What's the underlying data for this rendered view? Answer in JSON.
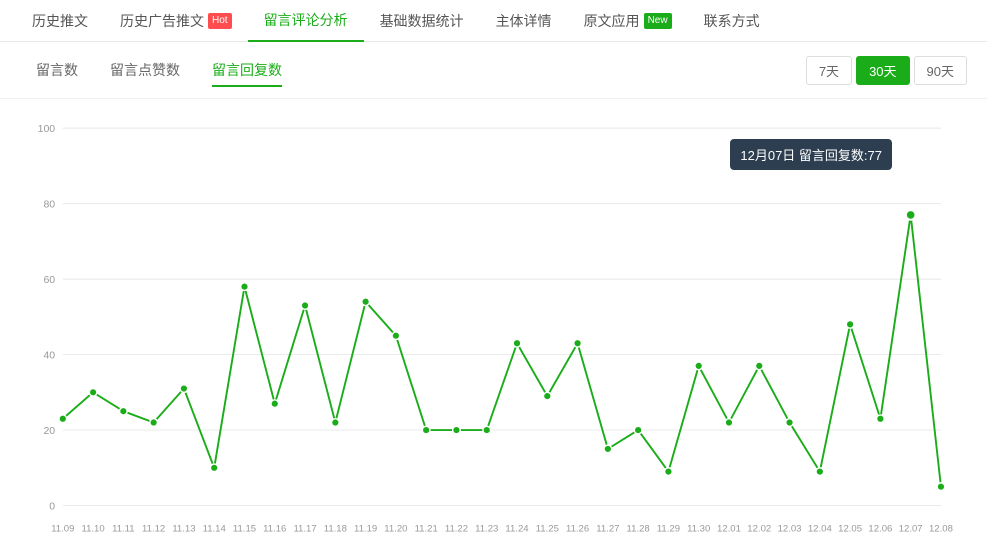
{
  "nav": {
    "items": [
      {
        "label": "历史推文",
        "active": false,
        "badge": null
      },
      {
        "label": "历史广告推文",
        "active": false,
        "badge": {
          "text": "Hot",
          "type": "hot"
        }
      },
      {
        "label": "留言评论分析",
        "active": true,
        "badge": null
      },
      {
        "label": "基础数据统计",
        "active": false,
        "badge": null
      },
      {
        "label": "主体详情",
        "active": false,
        "badge": null
      },
      {
        "label": "原文应用",
        "active": false,
        "badge": {
          "text": "New",
          "type": "new"
        }
      },
      {
        "label": "联系方式",
        "active": false,
        "badge": null
      }
    ]
  },
  "subnav": {
    "items": [
      {
        "label": "留言数",
        "active": false
      },
      {
        "label": "留言点赞数",
        "active": false
      },
      {
        "label": "留言回复数",
        "active": true
      }
    ],
    "timeOptions": [
      {
        "label": "7天",
        "active": false
      },
      {
        "label": "30天",
        "active": true
      },
      {
        "label": "90天",
        "active": false
      }
    ]
  },
  "chart": {
    "tooltip": {
      "date": "12月07日",
      "label": "留言回复数",
      "value": 77
    },
    "yLabels": [
      "0",
      "20",
      "40",
      "60",
      "80",
      "100"
    ],
    "xLabels": [
      "11.09",
      "11.10",
      "11.11",
      "11.12",
      "11.13",
      "11.14",
      "11.15",
      "11.16",
      "11.17",
      "11.18",
      "11.19",
      "11.20",
      "11.21",
      "11.22",
      "11.23",
      "11.24",
      "11.25",
      "11.26",
      "11.27",
      "11.28",
      "11.29",
      "11.30",
      "12.01",
      "12.02",
      "12.03",
      "12.04",
      "12.05",
      "12.06",
      "12.07",
      "12.08"
    ],
    "dataPoints": [
      23,
      30,
      25,
      22,
      31,
      10,
      58,
      27,
      53,
      22,
      54,
      45,
      20,
      20,
      20,
      43,
      29,
      43,
      15,
      20,
      9,
      37,
      22,
      37,
      22,
      9,
      48,
      23,
      77,
      5
    ]
  }
}
